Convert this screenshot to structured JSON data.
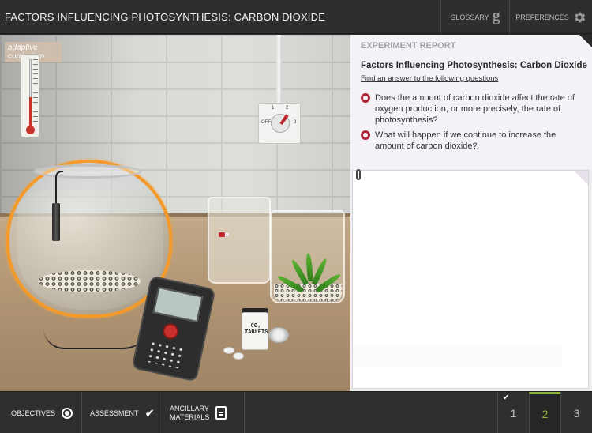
{
  "header": {
    "title": "FACTORS INFLUENCING PHOTOSYNTHESIS: CARBON DIOXIDE",
    "glossary_label": "GLOSSARY",
    "glossary_glyph": "g",
    "preferences_label": "PREFERENCES"
  },
  "scene": {
    "logo_line1": "adaptive",
    "logo_line2": "curriculum",
    "switch_labels": [
      "1",
      "2",
      "OFF",
      "3"
    ],
    "jar_label": "CO₂ TABLETS"
  },
  "report": {
    "section_label": "EXPERIMENT REPORT",
    "title": "Factors Influencing Photosynthesis: Carbon Dioxide",
    "instruction": "Find an answer to the following questions",
    "questions": [
      {
        "text": "Does the amount of carbon dioxide affect the rate of oxygen production, or more precisely, the rate of photosynthesis?"
      },
      {
        "text": "What will happen if we continue to increase the amount of carbon dioxide?"
      }
    ],
    "answer_value": ""
  },
  "footer": {
    "objectives_label": "OBJECTIVES",
    "assessment_label": "ASSESSMENT",
    "ancillary_line1": "ANCILLARY",
    "ancillary_line2": "MATERIALS",
    "pages": [
      "1",
      "2",
      "3"
    ],
    "current_page": "2",
    "completed_page": "1"
  },
  "colors": {
    "highlight_orange": "#f39a2a",
    "bullet_red": "#b1263a",
    "active_page_green": "#8fb63a"
  }
}
